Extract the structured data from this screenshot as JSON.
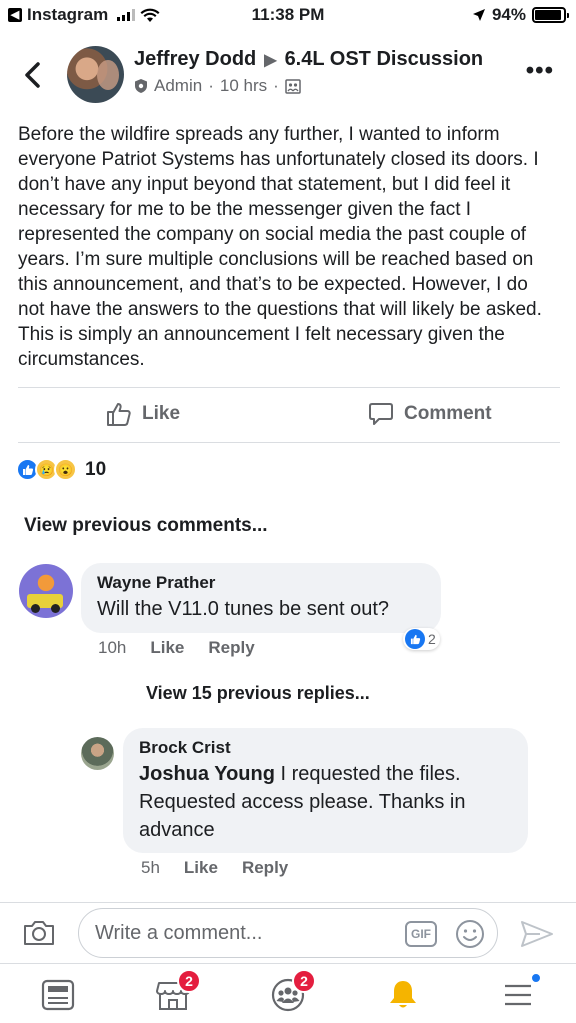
{
  "status_bar": {
    "back_app": "Instagram",
    "time": "11:38 PM",
    "battery": "94%"
  },
  "header": {
    "author": "Jeffrey Dodd",
    "group": "6.4L OST Discussion",
    "role": "Admin",
    "time": "10 hrs"
  },
  "post": {
    "text": "Before the wildfire spreads any further, I wanted to inform everyone Patriot Systems has unfortunately closed its doors. I don’t have any input beyond that statement, but I did feel it necessary for me to be the messenger given the fact I represented the company on social media the past couple of years. I’m sure multiple conclusions will be reached based on this announcement, and that’s to be expected. However, I do not have the answers to the questions that will likely be asked. This is simply an announcement I felt necessary given the circumstances."
  },
  "actions": {
    "like": "Like",
    "comment": "Comment"
  },
  "reactions": {
    "count": "10"
  },
  "comments": {
    "view_previous": "View previous comments...",
    "first": {
      "author": "Wayne Prather",
      "text": "Will the V11.0 tunes be sent out?",
      "time": "10h",
      "like": "Like",
      "reply": "Reply",
      "like_count": "2"
    },
    "view_replies": "View 15 previous replies...",
    "reply": {
      "author": "Brock Crist",
      "mention": "Joshua Young",
      "text": " I requested the files. Requested access please.  Thanks in advance",
      "time": "5h",
      "like": "Like",
      "reply": "Reply"
    }
  },
  "compose": {
    "placeholder": "Write a comment...",
    "gif": "GIF"
  },
  "nav": {
    "marketplace_badge": "2",
    "groups_badge": "2"
  },
  "colors": {
    "facebook_blue": "#1877f2",
    "badge_red": "#e41e3f",
    "secondary_text": "#65676b",
    "bubble_bg": "#f0f2f5",
    "bell_yellow": "#f5b400"
  }
}
